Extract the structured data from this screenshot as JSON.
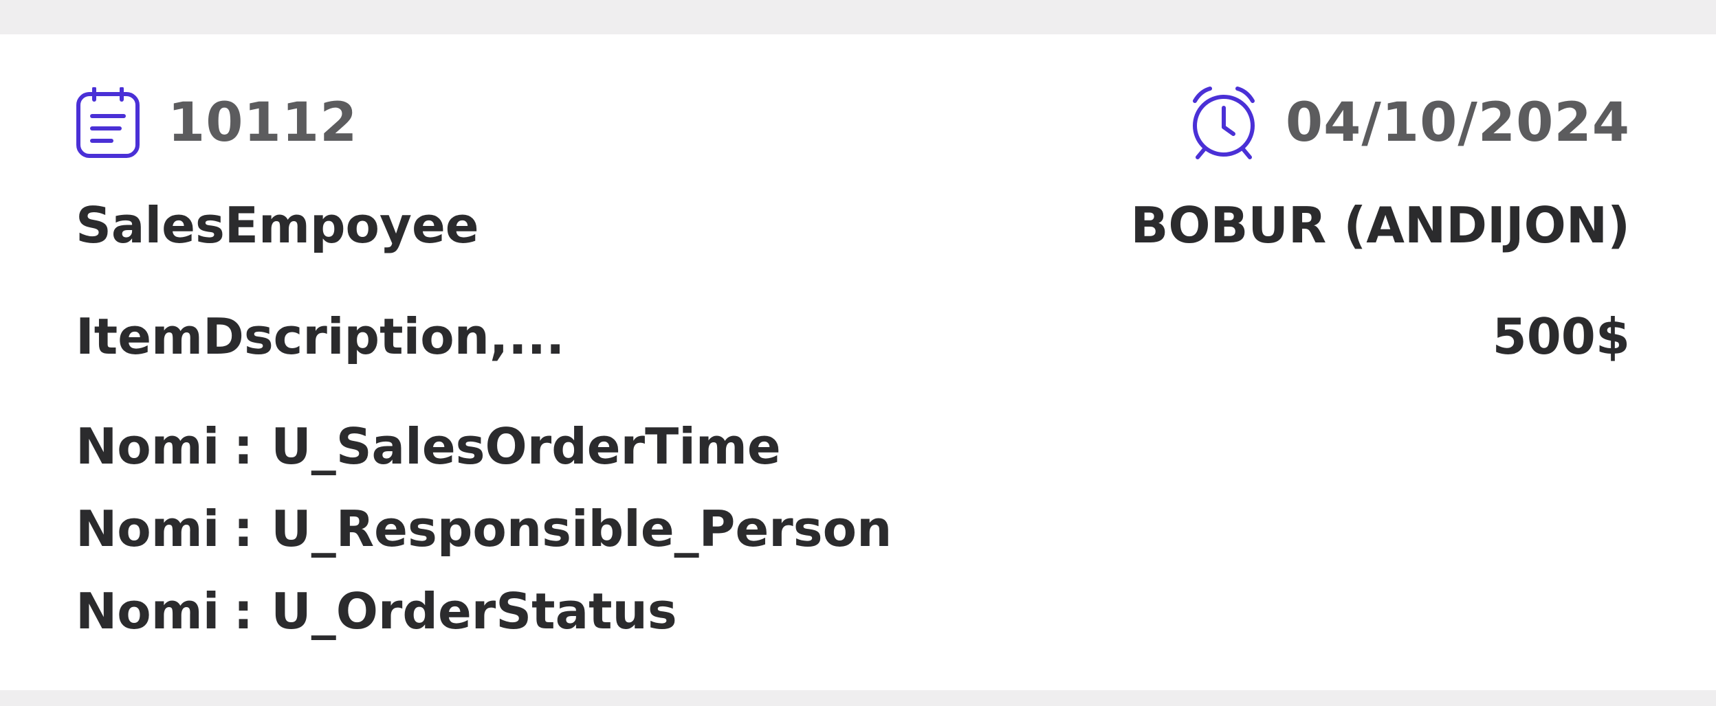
{
  "order": {
    "number": "10112",
    "date": "04/10/2024",
    "sales_employee_label": "SalesEmpoyee",
    "sales_employee_value": "BOBUR (ANDIJON)",
    "item_description": "ItemDscription,...",
    "amount": "500$"
  },
  "fields": [
    {
      "label": "Nomi",
      "separator": ":",
      "value": "U_SalesOrderTime"
    },
    {
      "label": "Nomi",
      "separator": ":",
      "value": "U_Responsible_Person"
    },
    {
      "label": "Nomi",
      "separator": ":",
      "value": "U_OrderStatus"
    }
  ],
  "icons": {
    "order_icon": "notepad-icon",
    "date_icon": "alarm-clock-icon",
    "accent_color": "#4a30d6"
  }
}
